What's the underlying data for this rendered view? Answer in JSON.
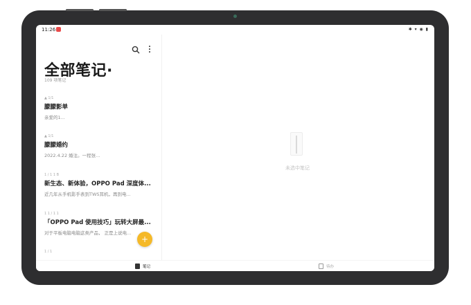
{
  "status": {
    "time": "11:26",
    "indicators": "✱ ▾ ◉ ▮"
  },
  "header": {
    "title": "全部笔记·",
    "count": "109 项笔记"
  },
  "notes": [
    {
      "meta": "▲ 1/1",
      "title": "朦朦影单",
      "preview": "亲爱的1..."
    },
    {
      "meta": "▲ 1/1",
      "title": "朦朦婚约",
      "preview": "2022.4.22  婚注。一程张..."
    },
    {
      "meta": "1 / 1 1 B",
      "title": "新生态、新体验，OPPO Pad 深度体...",
      "preview": "近几年从手机影手表到TWS耳机，再到电..."
    },
    {
      "meta": "1 1 / 1 1",
      "title": "「OPPO Pad 使用技巧」玩转大屏最...",
      "preview": "对于平板电脑电脑这类产品，  正是上说电..."
    },
    {
      "meta": "1 / 1",
      "title": "",
      "preview": ""
    }
  ],
  "fab": {
    "symbol": "+"
  },
  "empty": {
    "text": "未选中笔记"
  },
  "tabs": [
    {
      "label": "笔记",
      "active": true
    },
    {
      "label": "待办",
      "active": false
    }
  ],
  "colors": {
    "accent": "#f5b928",
    "badge": "#e94a4a",
    "bezel": "#2e2e30"
  }
}
